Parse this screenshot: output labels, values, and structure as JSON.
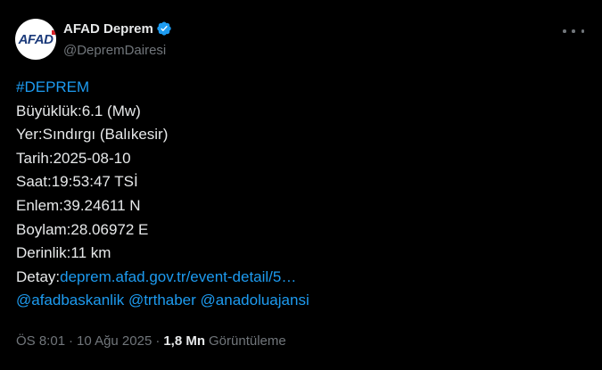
{
  "author": {
    "display_name": "AFAD Deprem",
    "handle": "@DepremDairesi",
    "avatar_text": "AFAD",
    "verified_icon": "verified-badge-icon",
    "verified_color": "#1d9bf0"
  },
  "tweet": {
    "hashtag": "#DEPREM",
    "magnitude": "Büyüklük:6.1 (Mw)",
    "location": "Yer:Sındırgı (Balıkesir)",
    "date": "Tarih:2025-08-10",
    "time": "Saat:19:53:47 TSİ",
    "latitude": "Enlem:39.24611 N",
    "longitude": "Boylam:28.06972 E",
    "depth": "Derinlik:11 km",
    "detail_label": "Detay:",
    "detail_link": "deprem.afad.gov.tr/event-detail/5…",
    "mentions": [
      "@afadbaskanlik",
      "@trthaber",
      "@anadoluajansi"
    ]
  },
  "meta": {
    "time": "ÖS 8:01",
    "separator": "·",
    "date": "10 Ağu 2025",
    "views_count": "1,8 Mn",
    "views_label": "Görüntüleme"
  },
  "more_icon": "more-dots-icon",
  "colors": {
    "background": "#000000",
    "text": "#e7e9ea",
    "secondary": "#71767b",
    "link": "#1d9bf0"
  }
}
